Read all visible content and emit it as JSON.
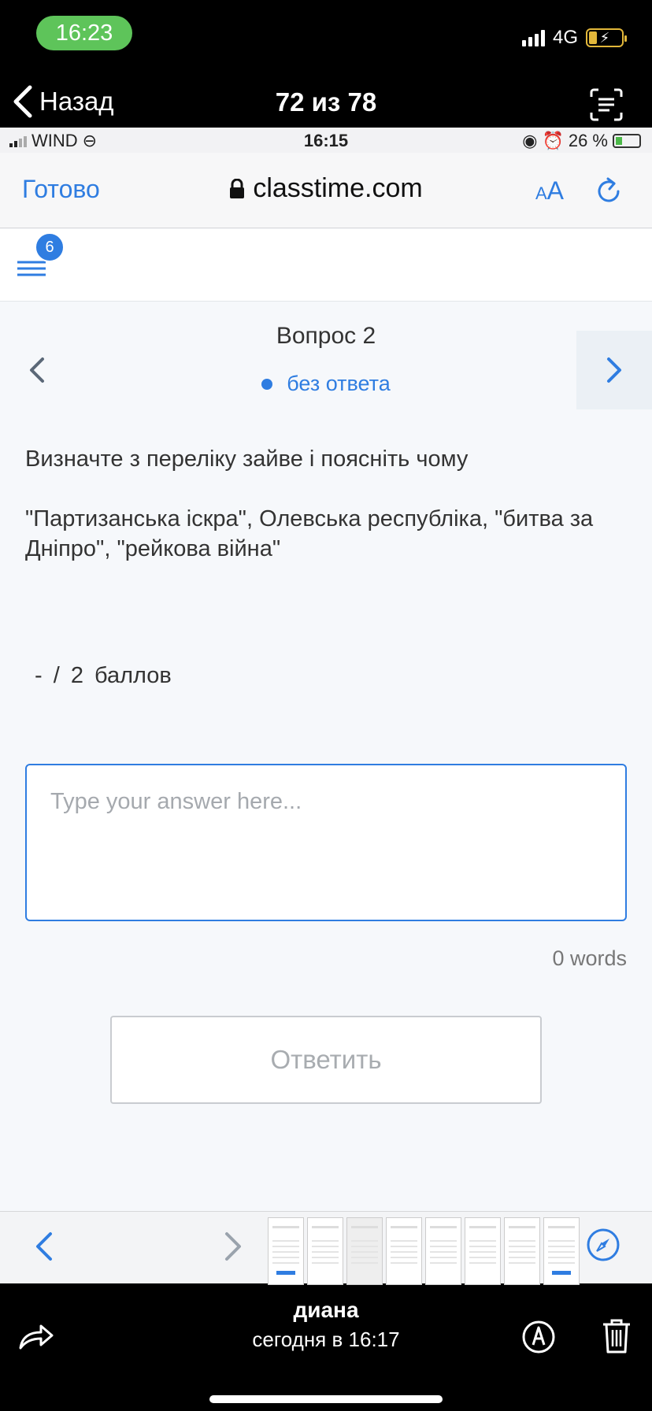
{
  "outer_status": {
    "time": "16:23",
    "network": "4G"
  },
  "viewer_nav": {
    "back_label": "Назад",
    "counter": "72 из 78"
  },
  "inner_status": {
    "carrier": "WIND",
    "time": "16:15",
    "battery": "26 %"
  },
  "safari": {
    "done_label": "Готово",
    "url": "classtime.com",
    "aa_small": "A",
    "aa_large": "A"
  },
  "app_header": {
    "badge_count": "6"
  },
  "question": {
    "title": "Вопрос 2",
    "status": "без ответа",
    "prompt": "Визначте з переліку зайве і поясніть чому",
    "items": "\"Партизанська іскра\", Олевська республіка, \"битва за Дніпро\", \"рейкова війна\"",
    "points": "- / 2 баллов"
  },
  "answer": {
    "placeholder": "Type your answer here...",
    "value": "",
    "word_count": "0 words"
  },
  "submit": {
    "label": "Ответить"
  },
  "photo_meta": {
    "author": "диана",
    "timestamp": "сегодня в 16:17"
  },
  "colors": {
    "accent": "#2f7de1",
    "pill_green": "#5ec45a",
    "battery_yellow": "#e2b73a"
  }
}
